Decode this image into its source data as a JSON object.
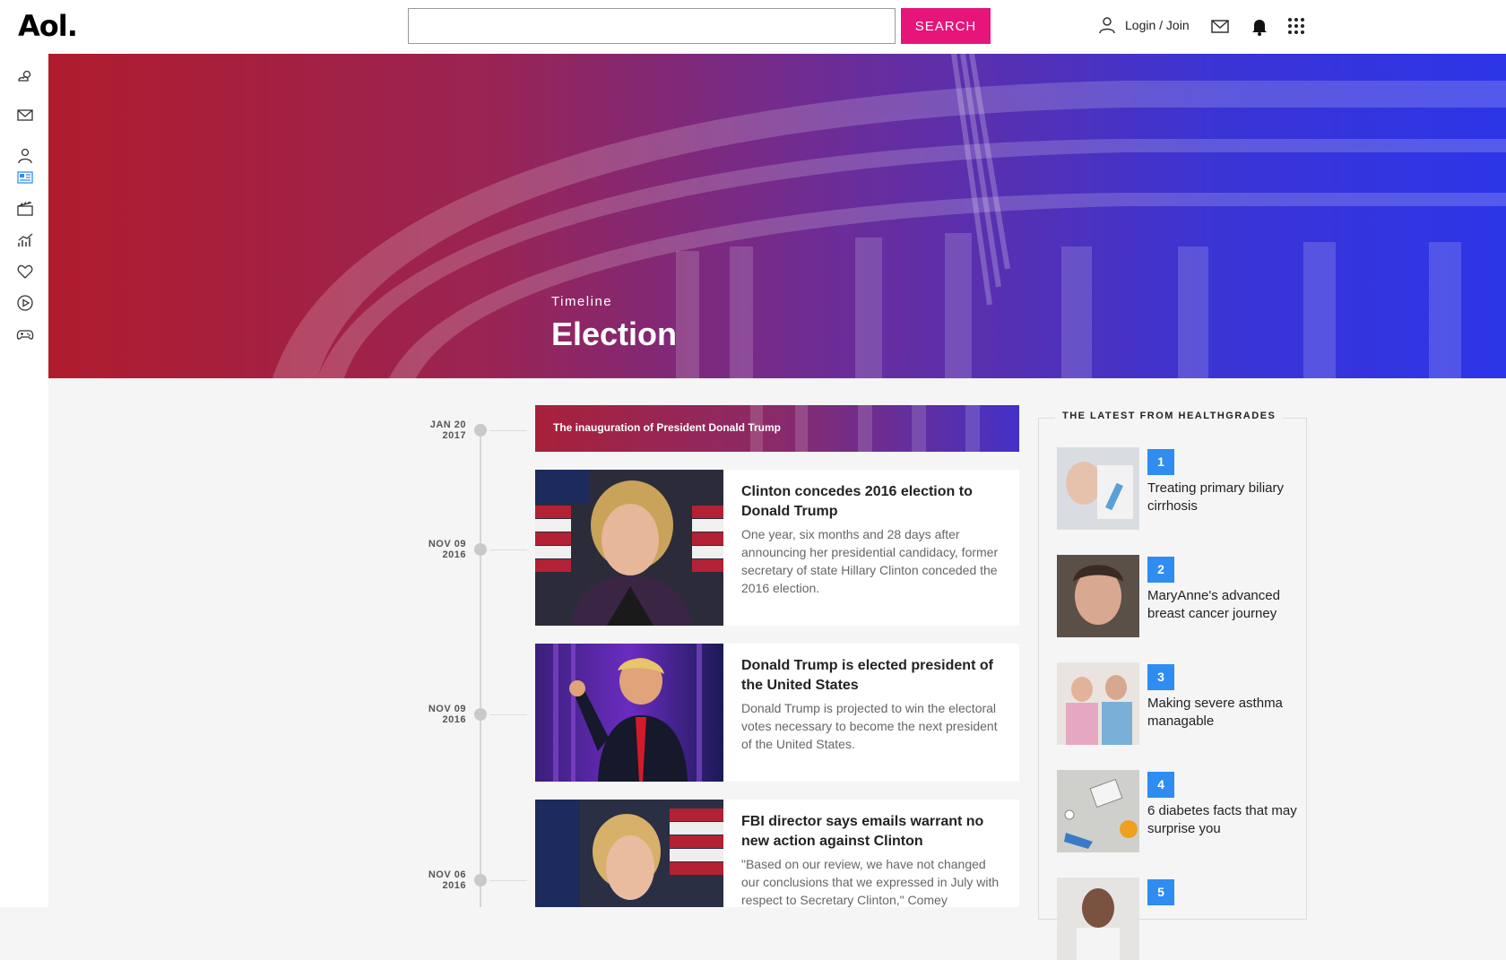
{
  "header": {
    "logo": "Aol.",
    "search_placeholder": "",
    "search_button": "SEARCH",
    "login_label": "Login / Join",
    "icons": [
      "user-icon",
      "mail-icon",
      "bell-icon",
      "apps-grid-icon"
    ],
    "accent_color": "#e5157a"
  },
  "sidebar": {
    "items": [
      "weather-icon",
      "mail-icon",
      "profile-icon",
      "news-icon",
      "movies-icon",
      "finance-icon",
      "health-icon",
      "video-icon",
      "games-icon"
    ]
  },
  "hero": {
    "eyebrow": "Timeline",
    "title": "Election"
  },
  "timeline": {
    "banner": {
      "date_line1": "JAN 20",
      "date_line2": "2017",
      "text": "The inauguration of President Donald Trump"
    },
    "items": [
      {
        "date_line1": "NOV 09",
        "date_line2": "2016",
        "title": "Clinton concedes 2016 election to Donald Trump",
        "description": "One year, six months and 28 days after announcing her presidential candidacy, former secretary of state Hillary Clinton conceded the 2016 election."
      },
      {
        "date_line1": "NOV 09",
        "date_line2": "2016",
        "title": "Donald Trump is elected president of the United States",
        "description": "Donald Trump is projected to win the electoral votes necessary to become the next president of the United States."
      },
      {
        "date_line1": "NOV 06",
        "date_line2": "2016",
        "title": "FBI director says emails warrant no new action against Clinton",
        "description": "\"Based on our review, we have not changed our conclusions that we expressed in July with respect to Secretary Clinton,\" Comey"
      }
    ]
  },
  "healthgrades": {
    "title": "THE LATEST FROM HEALTHGRADES",
    "items": [
      {
        "num": "1",
        "text": "Treating primary biliary cirrhosis"
      },
      {
        "num": "2",
        "text": "MaryAnne's advanced breast cancer journey"
      },
      {
        "num": "3",
        "text": "Making severe asthma managable"
      },
      {
        "num": "4",
        "text": "6 diabetes facts that may surprise you"
      },
      {
        "num": "5",
        "text": ""
      }
    ]
  }
}
